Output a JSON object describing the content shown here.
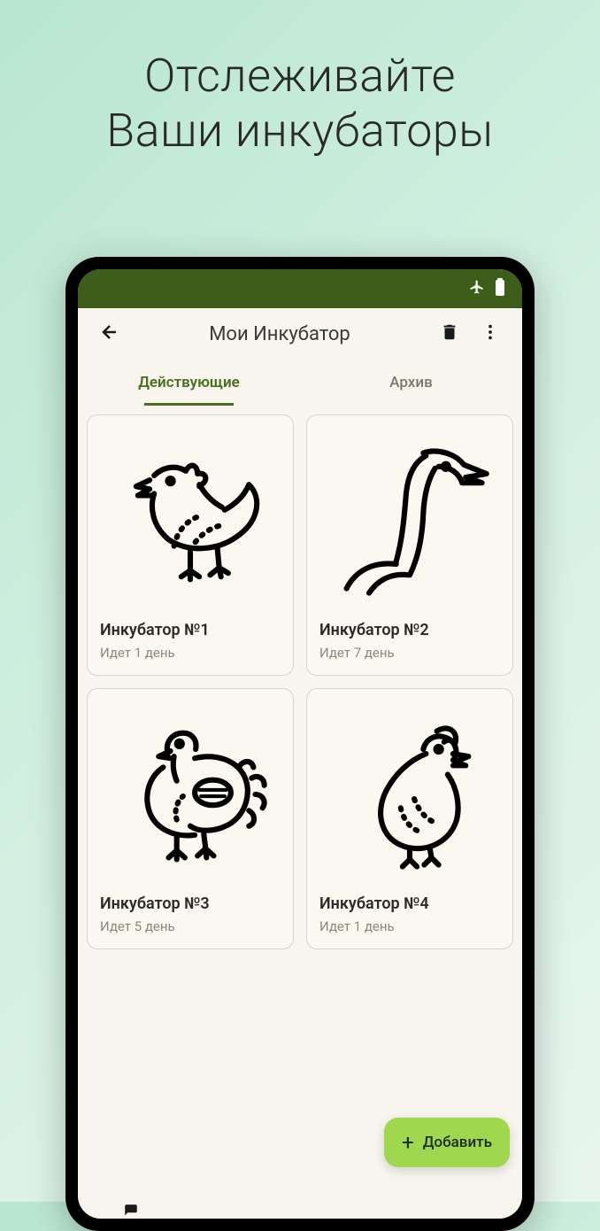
{
  "promo": {
    "line1": "Отслеживайте",
    "line2": "Ваши инкубаторы"
  },
  "appbar": {
    "title": "Мои Инкубатор"
  },
  "tabs": {
    "active": "Действующие",
    "archive": "Архив"
  },
  "cards": [
    {
      "title": "Инкубатор №1",
      "subtitle": "Идет 1 день",
      "icon": "chicken"
    },
    {
      "title": "Инкубатор №2",
      "subtitle": "Идет 7 день",
      "icon": "goose"
    },
    {
      "title": "Инкубатор №3",
      "subtitle": "Идет 5 день",
      "icon": "turkey"
    },
    {
      "title": "Инкубатор №4",
      "subtitle": "Идет 1 день",
      "icon": "quail"
    }
  ],
  "fab": {
    "label": "Добавить"
  }
}
